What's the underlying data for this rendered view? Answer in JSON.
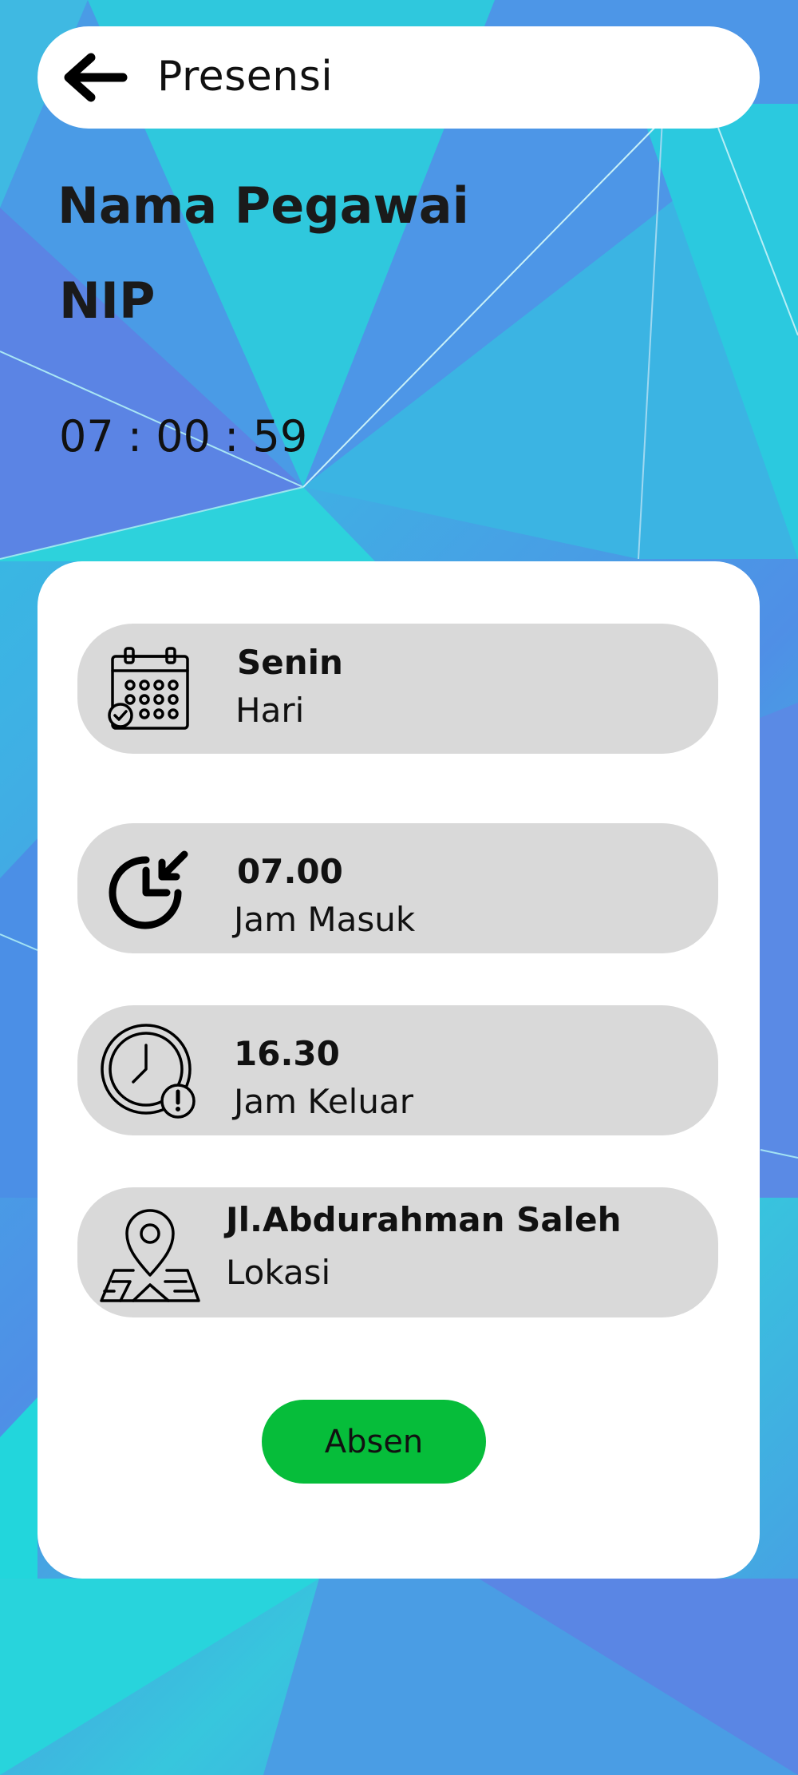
{
  "appbar": {
    "title": "Presensi",
    "back_icon": "arrow-left-icon"
  },
  "employee": {
    "name": "Nama Pegawai",
    "nip": "NIP"
  },
  "clock": "07 : 00 : 59",
  "details": [
    {
      "value": "Senin",
      "label": "Hari",
      "icon": "calendar-icon"
    },
    {
      "value": "07.00",
      "label": "Jam Masuk",
      "icon": "clock-in-icon"
    },
    {
      "value": "16.30",
      "label": "Jam Keluar",
      "icon": "clock-alert-icon"
    },
    {
      "value": "Jl.Abdurahman Saleh",
      "label": "Lokasi",
      "icon": "location-map-icon"
    }
  ],
  "absen_button": "Absen",
  "colors": {
    "button": "#06bd3a",
    "row_background": "#d9d9d9",
    "card": "#ffffff"
  }
}
